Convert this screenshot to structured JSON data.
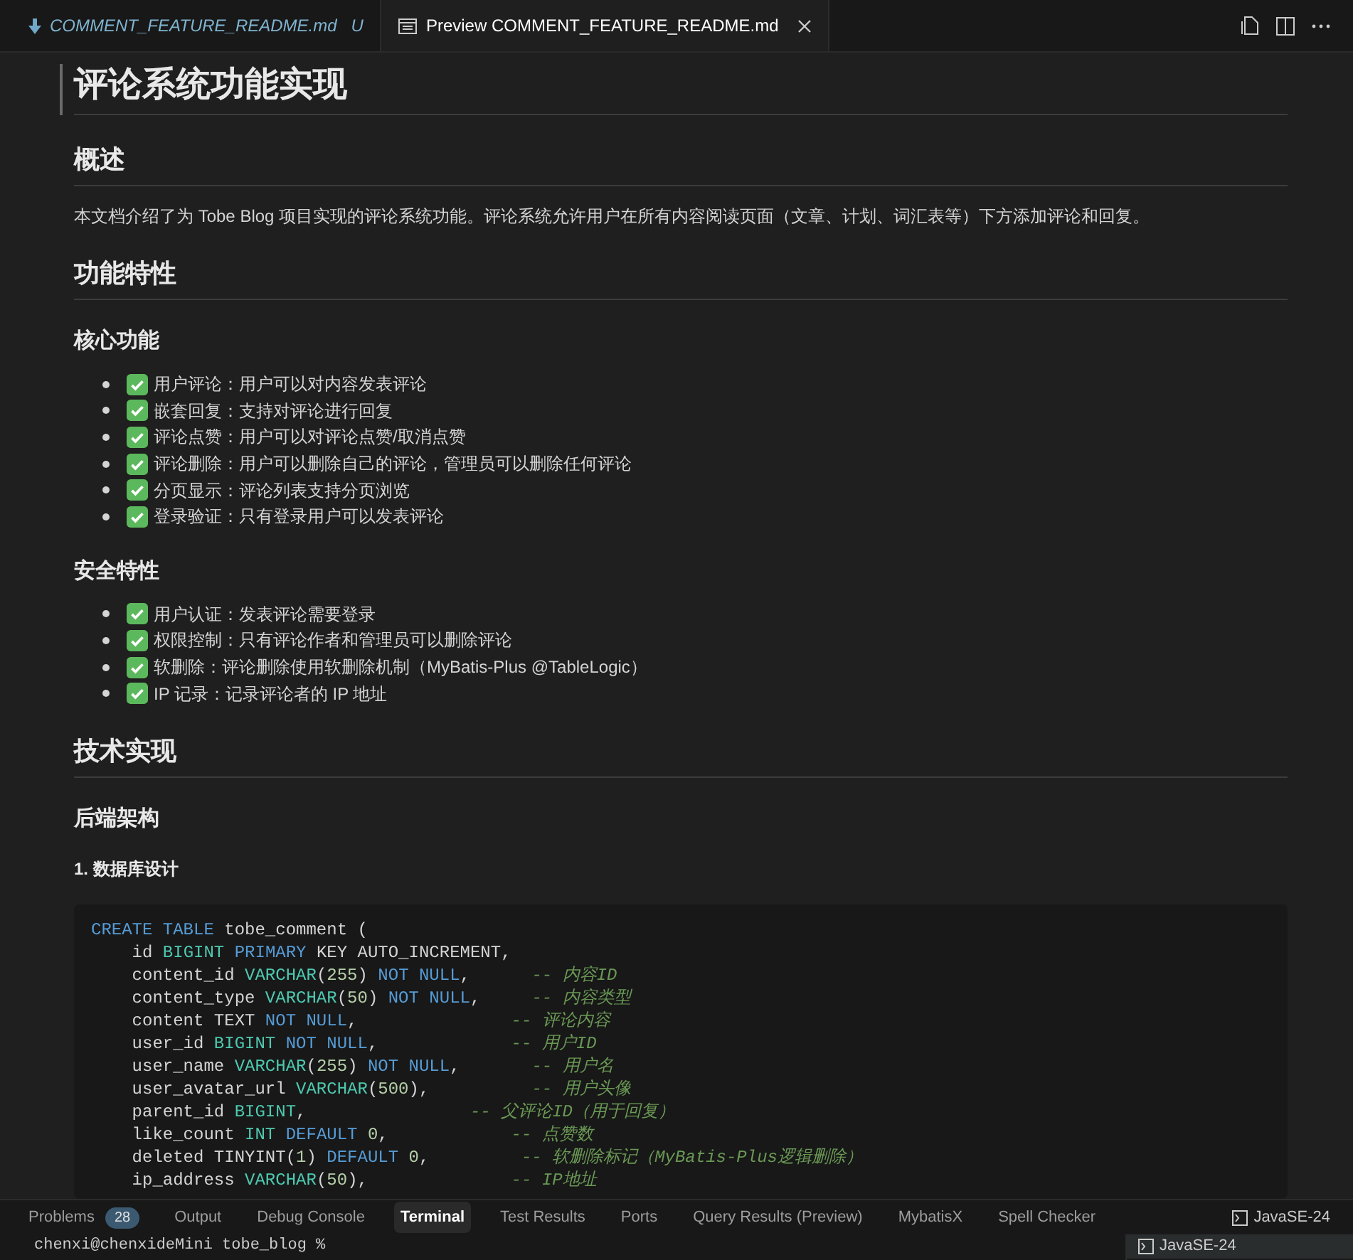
{
  "editor_tabs": [
    {
      "label": "COMMENT_FEATURE_README.md",
      "status": "U",
      "kind": "source",
      "selected": false
    },
    {
      "label": "Preview COMMENT_FEATURE_README.md",
      "kind": "preview",
      "selected": true
    }
  ],
  "document": [
    {
      "kind": "h1",
      "text": "评论系统功能实现"
    },
    {
      "kind": "h2",
      "text": "概述"
    },
    {
      "kind": "p",
      "text": "本文档介绍了为 Tobe Blog 项目实现的评论系统功能。评论系统允许用户在所有内容阅读页面（文章、计划、词汇表等）下方添加评论和回复。"
    },
    {
      "kind": "h2",
      "text": "功能特性"
    },
    {
      "kind": "h3",
      "text": "核心功能"
    },
    {
      "kind": "list",
      "items": [
        "用户评论：用户可以对内容发表评论",
        "嵌套回复：支持对评论进行回复",
        "评论点赞：用户可以对评论点赞/取消点赞",
        "评论删除：用户可以删除自己的评论，管理员可以删除任何评论",
        "分页显示：评论列表支持分页浏览",
        "登录验证：只有登录用户可以发表评论"
      ]
    },
    {
      "kind": "h3",
      "text": "安全特性"
    },
    {
      "kind": "list",
      "items": [
        "用户认证：发表评论需要登录",
        "权限控制：只有评论作者和管理员可以删除评论",
        "软删除：评论删除使用软删除机制（MyBatis-Plus @TableLogic）",
        "IP 记录：记录评论者的 IP 地址"
      ]
    },
    {
      "kind": "h2",
      "text": "技术实现"
    },
    {
      "kind": "h3",
      "text": "后端架构"
    },
    {
      "kind": "h4",
      "text": "1. 数据库设计"
    },
    {
      "kind": "code",
      "lines": [
        [
          {
            "kind": "keyword",
            "text": "CREATE TABLE"
          },
          {
            "kind": "plain",
            "text": " tobe_comment ("
          }
        ],
        [
          {
            "kind": "plain",
            "text": "    id "
          },
          {
            "kind": "type",
            "text": "BIGINT"
          },
          {
            "kind": "keyword",
            "text": " PRIMARY"
          },
          {
            "kind": "plain",
            "text": " KEY AUTO_INCREMENT,"
          }
        ],
        [
          {
            "kind": "plain",
            "text": "    content_id "
          },
          {
            "kind": "type",
            "text": "VARCHAR"
          },
          {
            "kind": "plain",
            "text": "("
          },
          {
            "kind": "number",
            "text": "255"
          },
          {
            "kind": "plain",
            "text": ") "
          },
          {
            "kind": "keyword",
            "text": "NOT NULL"
          },
          {
            "kind": "plain",
            "text": ",      "
          },
          {
            "kind": "comment",
            "text": "-- 内容ID"
          }
        ],
        [
          {
            "kind": "plain",
            "text": "    content_type "
          },
          {
            "kind": "type",
            "text": "VARCHAR"
          },
          {
            "kind": "plain",
            "text": "("
          },
          {
            "kind": "number",
            "text": "50"
          },
          {
            "kind": "plain",
            "text": ") "
          },
          {
            "kind": "keyword",
            "text": "NOT NULL"
          },
          {
            "kind": "plain",
            "text": ",     "
          },
          {
            "kind": "comment",
            "text": "-- 内容类型"
          }
        ],
        [
          {
            "kind": "plain",
            "text": "    content TEXT "
          },
          {
            "kind": "keyword",
            "text": "NOT NULL"
          },
          {
            "kind": "plain",
            "text": ",               "
          },
          {
            "kind": "comment",
            "text": "-- 评论内容"
          }
        ],
        [
          {
            "kind": "plain",
            "text": "    user_id "
          },
          {
            "kind": "type",
            "text": "BIGINT"
          },
          {
            "kind": "keyword",
            "text": " NOT NULL"
          },
          {
            "kind": "plain",
            "text": ",             "
          },
          {
            "kind": "comment",
            "text": "-- 用户ID"
          }
        ],
        [
          {
            "kind": "plain",
            "text": "    user_name "
          },
          {
            "kind": "type",
            "text": "VARCHAR"
          },
          {
            "kind": "plain",
            "text": "("
          },
          {
            "kind": "number",
            "text": "255"
          },
          {
            "kind": "plain",
            "text": ") "
          },
          {
            "kind": "keyword",
            "text": "NOT NULL"
          },
          {
            "kind": "plain",
            "text": ",       "
          },
          {
            "kind": "comment",
            "text": "-- 用户名"
          }
        ],
        [
          {
            "kind": "plain",
            "text": "    user_avatar_url "
          },
          {
            "kind": "type",
            "text": "VARCHAR"
          },
          {
            "kind": "plain",
            "text": "("
          },
          {
            "kind": "number",
            "text": "500"
          },
          {
            "kind": "plain",
            "text": "),          "
          },
          {
            "kind": "comment",
            "text": "-- 用户头像"
          }
        ],
        [
          {
            "kind": "plain",
            "text": "    parent_id "
          },
          {
            "kind": "type",
            "text": "BIGINT"
          },
          {
            "kind": "plain",
            "text": ",                "
          },
          {
            "kind": "comment",
            "text": "-- 父评论ID（用于回复）"
          }
        ],
        [
          {
            "kind": "plain",
            "text": "    like_count "
          },
          {
            "kind": "type",
            "text": "INT"
          },
          {
            "kind": "keyword",
            "text": " DEFAULT"
          },
          {
            "kind": "number",
            "text": " 0"
          },
          {
            "kind": "plain",
            "text": ",            "
          },
          {
            "kind": "comment",
            "text": "-- 点赞数"
          }
        ],
        [
          {
            "kind": "plain",
            "text": "    deleted TINYINT("
          },
          {
            "kind": "number",
            "text": "1"
          },
          {
            "kind": "plain",
            "text": ")"
          },
          {
            "kind": "keyword",
            "text": " DEFAULT"
          },
          {
            "kind": "number",
            "text": " 0"
          },
          {
            "kind": "plain",
            "text": ",         "
          },
          {
            "kind": "comment",
            "text": "-- 软删除标记（MyBatis-Plus逻辑删除）"
          }
        ],
        [
          {
            "kind": "plain",
            "text": "    ip_address "
          },
          {
            "kind": "type",
            "text": "VARCHAR"
          },
          {
            "kind": "plain",
            "text": "("
          },
          {
            "kind": "number",
            "text": "50"
          },
          {
            "kind": "plain",
            "text": "),              "
          },
          {
            "kind": "comment",
            "text": "-- IP地址"
          }
        ]
      ]
    }
  ],
  "panel": {
    "tabs": [
      {
        "label": "Problems",
        "badge": "28",
        "selected": false
      },
      {
        "label": "Output",
        "selected": false
      },
      {
        "label": "Debug Console",
        "selected": false
      },
      {
        "label": "Terminal",
        "selected": true
      },
      {
        "label": "Test Results",
        "selected": false
      },
      {
        "label": "Ports",
        "selected": false
      },
      {
        "label": "Query Results (Preview)",
        "selected": false
      },
      {
        "label": "MybatisX",
        "selected": false
      },
      {
        "label": "Spell Checker",
        "selected": false
      }
    ],
    "terminal_title": "JavaSE-24",
    "terminal_prompt": "chenxi@chenxideMini tobe_blog %",
    "terminals": [
      {
        "label": "JavaSE-24",
        "selected": true
      }
    ]
  }
}
